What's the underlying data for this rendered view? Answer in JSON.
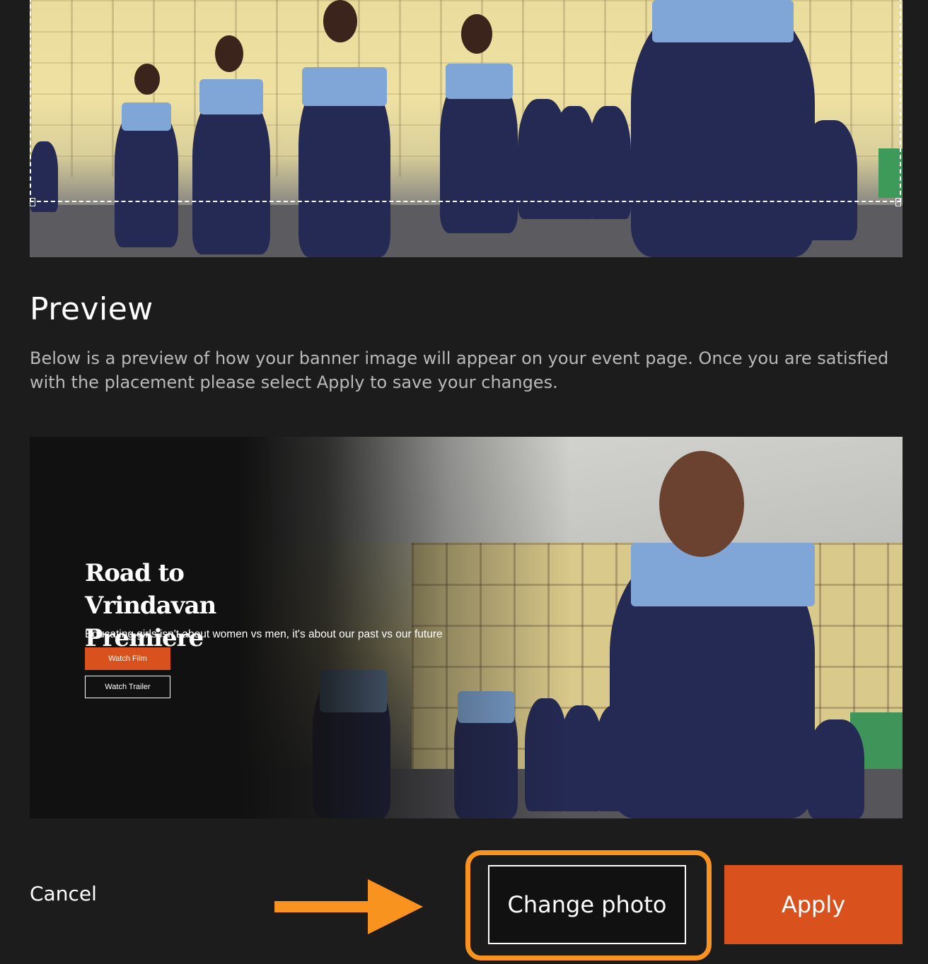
{
  "preview": {
    "title": "Preview",
    "description": "Below is a preview of how your banner image will appear on your event page. Once you are satisfied with the placement please select Apply to save your changes."
  },
  "banner": {
    "title": "Road to Vrindavan Premiere",
    "subtitle": "Educating girls isn't about women vs men, it's about our past vs our future",
    "watch_film_label": "Watch Film",
    "watch_trailer_label": "Watch Trailer"
  },
  "actions": {
    "cancel_label": "Cancel",
    "change_photo_label": "Change photo",
    "apply_label": "Apply"
  },
  "colors": {
    "accent": "#d9521e",
    "highlight": "#f7931e",
    "background": "#1c1c1c"
  }
}
